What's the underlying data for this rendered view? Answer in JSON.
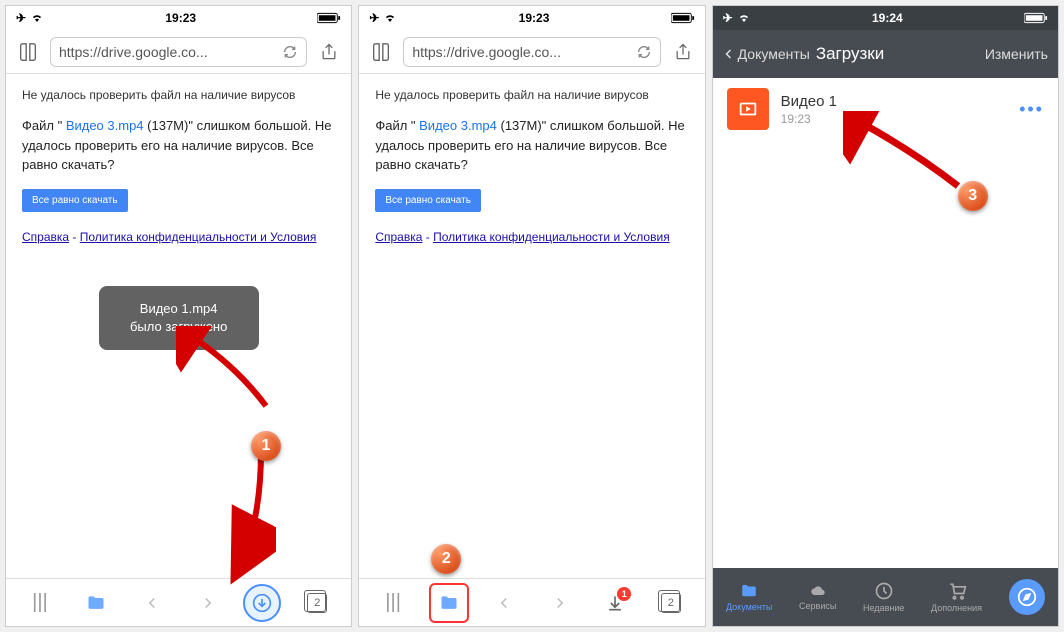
{
  "statusbar": {
    "time1": "19:23",
    "time2": "19:23",
    "time3": "19:24"
  },
  "url": "https://drive.google.co...",
  "virus": {
    "title": "Не удалось проверить файл на наличие вирусов",
    "prefix": "Файл \" ",
    "filename": "Видео 3.mp4",
    "suffix": " (137M)\" слишком большой. Не удалось проверить его на наличие вирусов. Все равно скачать?",
    "button": "Все равно скачать"
  },
  "footer": {
    "help": "Справка",
    "sep": " - ",
    "privacy": "Политика конфиденциальности и Условия "
  },
  "toast": {
    "line1": "Видео 1.mp4",
    "line2": "было загружено"
  },
  "bottombar": {
    "tabs": "2",
    "badge": "1"
  },
  "screen3": {
    "back": "Документы",
    "title": "Загрузки",
    "edit": "Изменить",
    "file": {
      "name": "Видео 1",
      "time": "19:23",
      "more": "•••"
    },
    "tabs": {
      "docs": "Документы",
      "services": "Сервисы",
      "recent": "Недавние",
      "addons": "Дополнения"
    }
  },
  "steps": {
    "s1": "1",
    "s2": "2",
    "s3": "3"
  }
}
